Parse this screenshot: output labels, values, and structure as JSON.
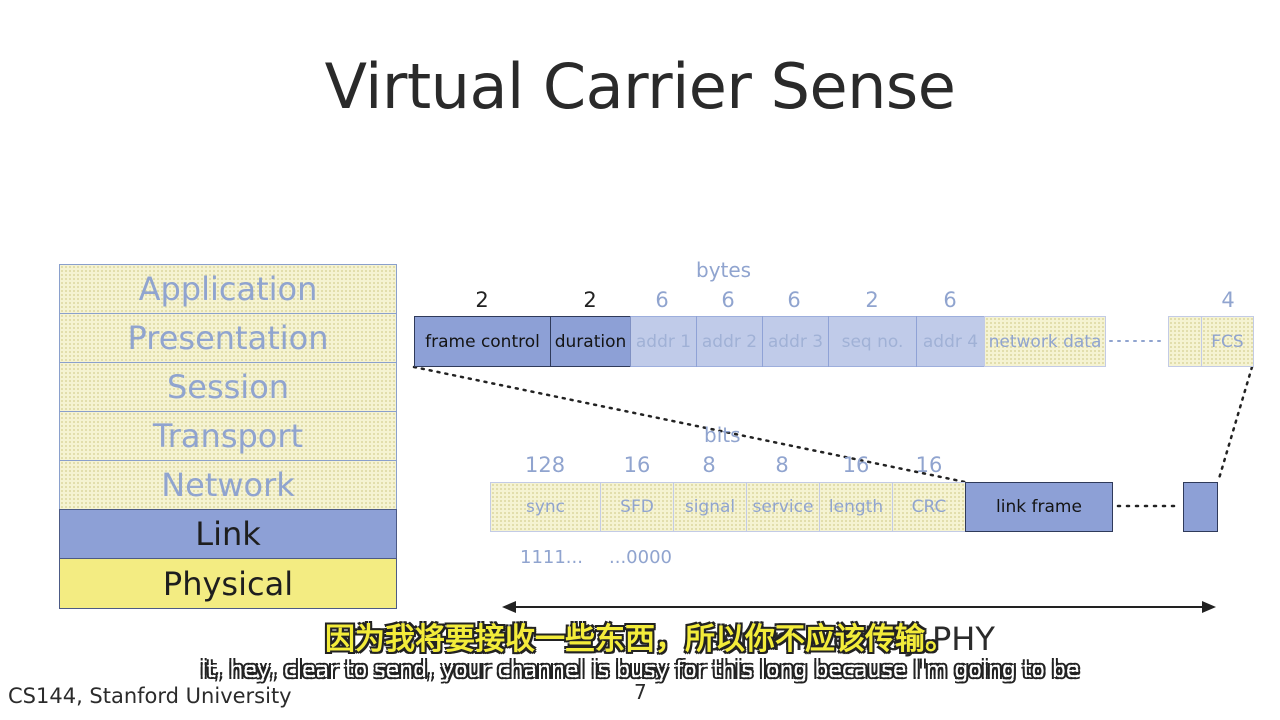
{
  "title": "Virtual Carrier Sense",
  "stack": [
    "Application",
    "Presentation",
    "Session",
    "Transport",
    "Network",
    "Link",
    "Physical"
  ],
  "mac_frame": {
    "unit": "bytes",
    "sizes": [
      "2",
      "2",
      "6",
      "6",
      "6",
      "2",
      "6",
      "4"
    ],
    "fields": [
      "frame control",
      "duration",
      "addr 1",
      "addr 2",
      "addr 3",
      "seq no.",
      "addr 4",
      "network data",
      "FCS"
    ]
  },
  "phy_frame": {
    "unit": "bits",
    "sizes": [
      "128",
      "16",
      "8",
      "8",
      "16",
      "16"
    ],
    "fields": [
      "sync",
      "SFD",
      "signal",
      "service",
      "length",
      "CRC",
      "link frame"
    ],
    "sync_bits": "1111...",
    "sfd_bits": "...0000"
  },
  "scrambled_label": "scrambled by PHY",
  "subtitle_cn": "因为我将要接收一些东西，所以你不应该传输。",
  "subtitle_en": "it, hey, clear to send, your channel is busy for this long because I'm going to be",
  "footer": "CS144, Stanford University",
  "page_number": "7"
}
